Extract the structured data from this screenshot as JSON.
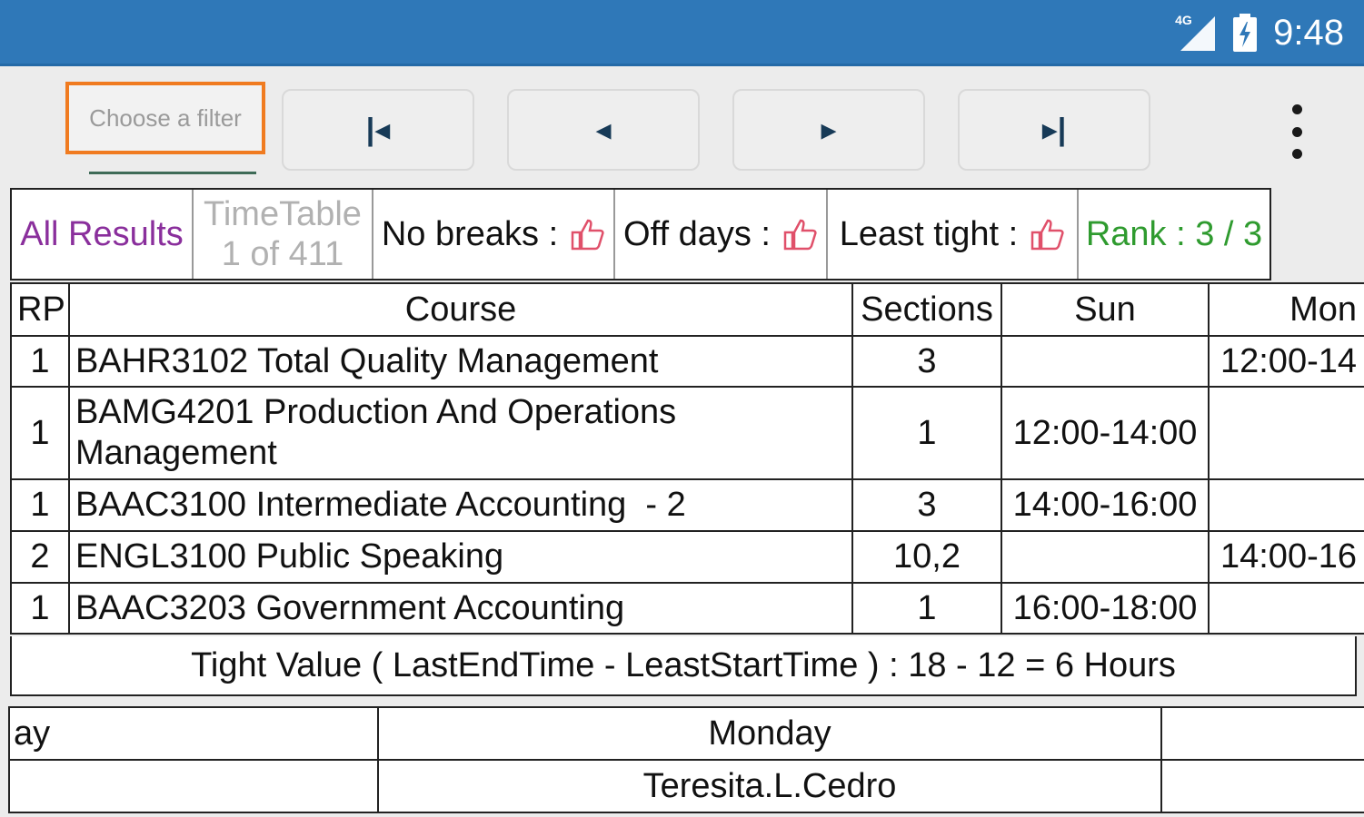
{
  "status_bar": {
    "network": "4G",
    "time": "9:48",
    "icons": [
      "signal-icon",
      "battery-charging-icon"
    ]
  },
  "toolbar": {
    "filter_placeholder": "Choose a filter",
    "first_label": "|◂",
    "prev_label": "◂",
    "next_label": "▸",
    "last_label": "▸|",
    "overflow_icon": "more-vertical-icon"
  },
  "summary": {
    "all_results": "All Results",
    "timetable_label": "TimeTable",
    "timetable_count": "1 of 411",
    "no_breaks": "No breaks :",
    "off_days": "Off days :",
    "least_tight": "Least tight :",
    "rank": "Rank : 3 / 3",
    "thumb_icon": "thumbs-up-icon",
    "colors": {
      "all_results": "#8a2f9c",
      "rank": "#2f9b2f",
      "thumb": "#e0506a"
    }
  },
  "schedule": {
    "headers": {
      "rp": "RP",
      "course": "Course",
      "sections": "Sections",
      "sun": "Sun",
      "mon": "Mon"
    },
    "rows": [
      {
        "rp": "1",
        "course": "BAHR3102 Total Quality Management",
        "sections": "3",
        "sun": "",
        "mon": "12:00-14"
      },
      {
        "rp": "1",
        "course": "BAMG4201 Production And Operations Management",
        "sections": "1",
        "sun": "12:00-14:00",
        "mon": ""
      },
      {
        "rp": "1",
        "course": "BAAC3100 Intermediate Accounting  - 2",
        "sections": "3",
        "sun": "14:00-16:00",
        "mon": ""
      },
      {
        "rp": "2",
        "course": "ENGL3100 Public Speaking",
        "sections": "10,2",
        "sun": "",
        "mon": "14:00-16"
      },
      {
        "rp": "1",
        "course": "BAAC3203 Government Accounting",
        "sections": "1",
        "sun": "16:00-18:00",
        "mon": ""
      }
    ],
    "tight_value": "Tight Value ( LastEndTime - LeastStartTime ) : 18 - 12 = 6 Hours"
  },
  "detail": {
    "row1": {
      "left": "ay",
      "middle": "Monday",
      "right": ""
    },
    "row2": {
      "left": "",
      "middle": "Teresita.L.Cedro",
      "right": ""
    }
  }
}
